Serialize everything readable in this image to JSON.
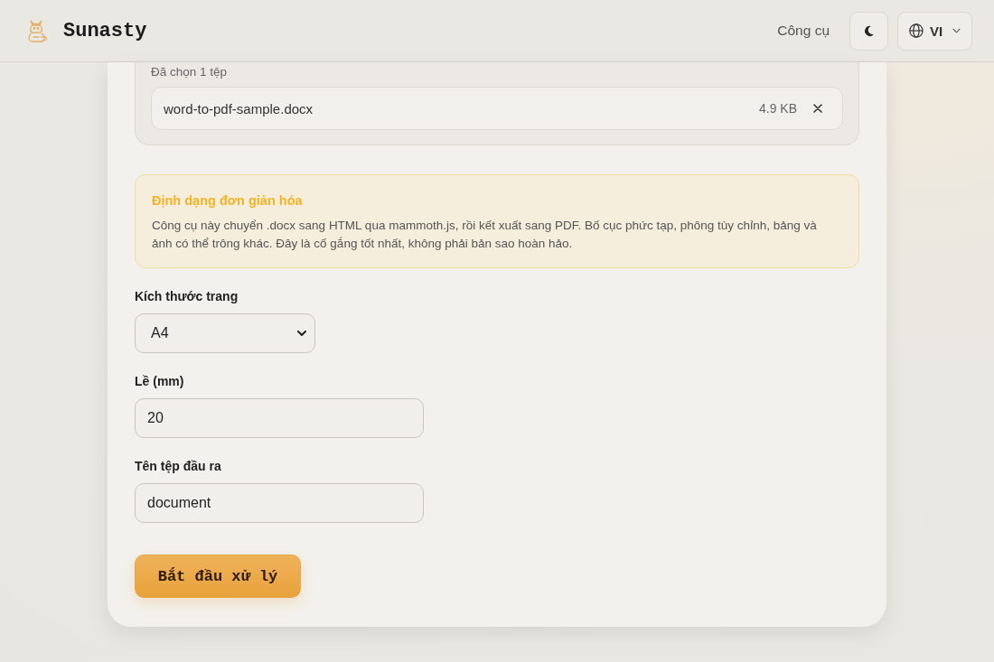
{
  "header": {
    "brand": "Sunasty",
    "nav_link": "Công cụ",
    "language": "VI"
  },
  "upload": {
    "status": "Đã chọn 1 tệp",
    "files": [
      {
        "name": "word-to-pdf-sample.docx",
        "size": "4.9 KB"
      }
    ]
  },
  "notice": {
    "title": "Định dạng đơn giản hóa",
    "body": "Công cụ này chuyển .docx sang HTML qua mammoth.js, rồi kết xuất sang PDF. Bố cục phức tạp, phông tùy chỉnh, bảng và ảnh có thể trông khác. Đây là cố gắng tốt nhất, không phải bản sao hoàn hảo."
  },
  "fields": [
    {
      "kind": "select",
      "label": "Kích thước trang",
      "value": "A4"
    },
    {
      "kind": "input",
      "label": "Lề (mm)",
      "value": "20"
    },
    {
      "kind": "input",
      "label": "Tên tệp đầu ra",
      "value": "document"
    }
  ],
  "submit": {
    "label": "Bắt đầu xử lý"
  }
}
